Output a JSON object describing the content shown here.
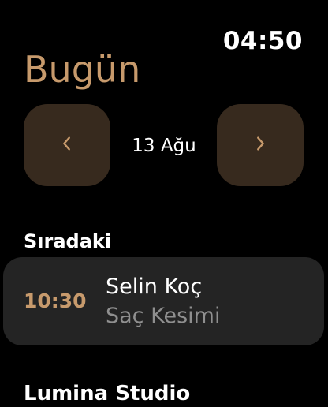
{
  "status": {
    "time": "04:50"
  },
  "header": {
    "title": "Bugün"
  },
  "date_nav": {
    "current_date": "13 Ağu",
    "prev_icon": "chevron-left-icon",
    "next_icon": "chevron-right-icon"
  },
  "upcoming": {
    "label": "Sıradaki",
    "appointment": {
      "time": "10:30",
      "client": "Selin Koç",
      "service": "Saç Kesimi"
    }
  },
  "studio": {
    "name": "Lumina Studio"
  },
  "colors": {
    "accent": "#c79a6c",
    "button_bg": "#372a1e",
    "card_bg": "#242424",
    "secondary_text": "#8f8f8f",
    "background": "#000000"
  }
}
